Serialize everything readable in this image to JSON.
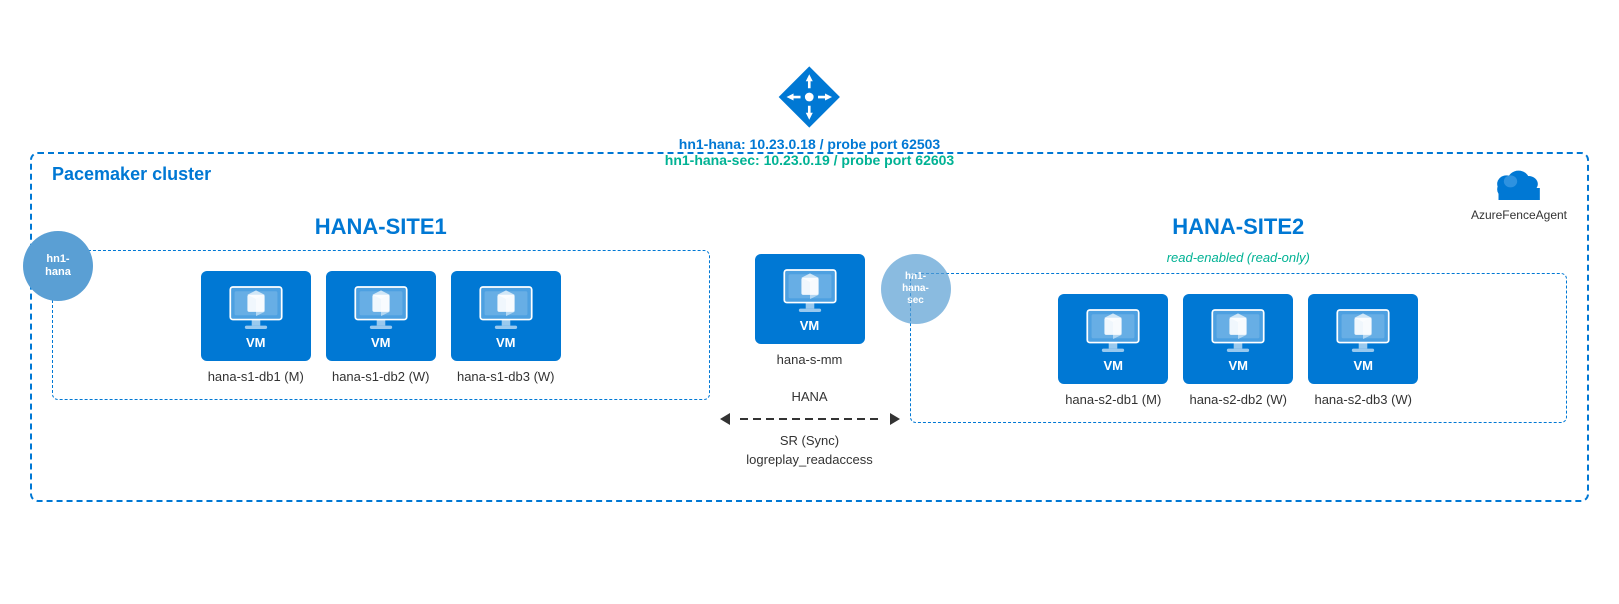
{
  "diagram": {
    "pacemaker_label": "Pacemaker cluster",
    "azure_fence_label": "AzureFenceAgent",
    "lb": {
      "label_primary": "hn1-hana:  10.23.0.18 / probe port 62503",
      "label_secondary": "hn1-hana-sec:  10.23.0.19 / probe port 62603"
    },
    "site1": {
      "title": "HANA-SITE1",
      "vip_badge": "hn1-\nhana",
      "nodes": [
        {
          "label": "hana-s1-db1 (M)"
        },
        {
          "label": "hana-s1-db2 (W)"
        },
        {
          "label": "hana-s1-db3 (W)"
        }
      ]
    },
    "middle": {
      "node_label": "hana-s-mm"
    },
    "sync": {
      "line1": "HANA",
      "line2": "SR (Sync)",
      "line3": "logreplay_readaccess"
    },
    "site2": {
      "title": "HANA-SITE2",
      "vip_badge": "hn1-\nhana-\nsec",
      "read_enabled": "read-enabled (read-only)",
      "nodes": [
        {
          "label": "hana-s2-db1 (M)"
        },
        {
          "label": "hana-s2-db2 (W)"
        },
        {
          "label": "hana-s2-db3 (W)"
        }
      ]
    }
  }
}
